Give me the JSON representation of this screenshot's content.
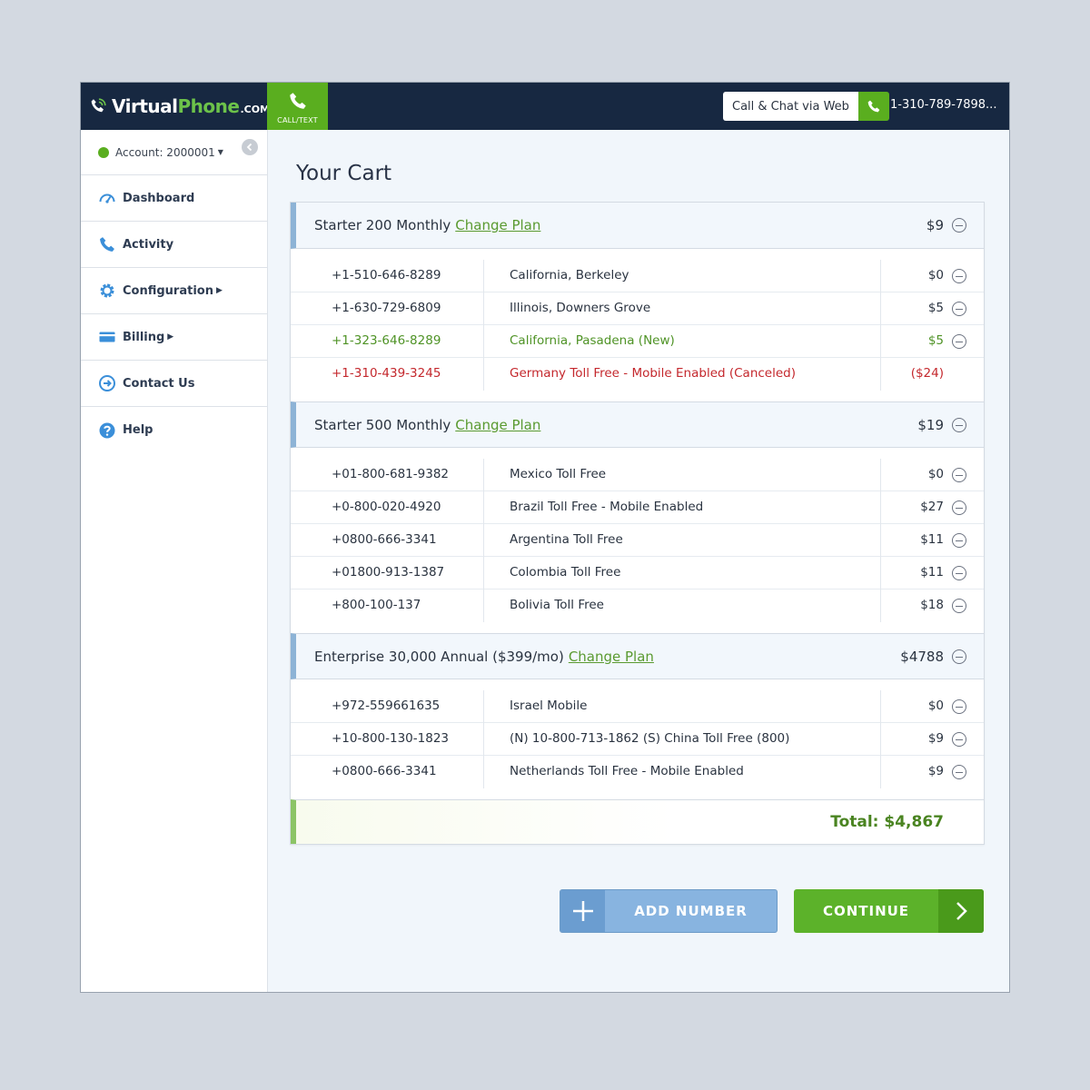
{
  "header": {
    "logo_virtual": "Virtual",
    "logo_phone": "Phone",
    "logo_com": ".COM",
    "call_text_label": "CALL/TEXT",
    "web_call_label": "Call & Chat via Web",
    "phone_number": "1-310-789-7898..."
  },
  "sidebar": {
    "account_label": "Account: 2000001",
    "items": [
      {
        "label": "Dashboard",
        "icon": "dashboard-icon"
      },
      {
        "label": "Activity",
        "icon": "phone-icon"
      },
      {
        "label": "Configuration",
        "icon": "gear-icon",
        "has_caret": true
      },
      {
        "label": "Billing",
        "icon": "credit-card-icon",
        "has_caret": true
      },
      {
        "label": "Contact Us",
        "icon": "contact-icon"
      },
      {
        "label": "Help",
        "icon": "help-icon"
      }
    ]
  },
  "main": {
    "title": "Your Cart",
    "change_plan_label": "Change Plan",
    "plans": [
      {
        "name": "Starter 200 Monthly",
        "price": "$9",
        "lines": [
          {
            "number": "+1-510-646-8289",
            "location": "California, Berkeley",
            "price": "$0",
            "status": "normal"
          },
          {
            "number": "+1-630-729-6809",
            "location": "Illinois, Downers Grove",
            "price": "$5",
            "status": "normal"
          },
          {
            "number": "+1-323-646-8289",
            "location": "California, Pasadena (New)",
            "price": "$5",
            "status": "new"
          },
          {
            "number": "+1-310-439-3245",
            "location": "Germany Toll Free - Mobile Enabled (Canceled)",
            "price": "($24)",
            "status": "canceled"
          }
        ]
      },
      {
        "name": "Starter 500 Monthly",
        "price": "$19",
        "lines": [
          {
            "number": "+01-800-681-9382",
            "location": "Mexico Toll Free",
            "price": "$0",
            "status": "normal"
          },
          {
            "number": "+0-800-020-4920",
            "location": "Brazil Toll Free - Mobile Enabled",
            "price": "$27",
            "status": "normal"
          },
          {
            "number": "+0800-666-3341",
            "location": "Argentina Toll Free",
            "price": "$11",
            "status": "normal"
          },
          {
            "number": "+01800-913-1387",
            "location": "Colombia Toll Free",
            "price": "$11",
            "status": "normal"
          },
          {
            "number": "+800-100-137",
            "location": "Bolivia Toll Free",
            "price": "$18",
            "status": "normal"
          }
        ]
      },
      {
        "name": "Enterprise 30,000 Annual ($399/mo)",
        "price": "$4788",
        "lines": [
          {
            "number": "+972-559661635",
            "location": "Israel Mobile",
            "price": "$0",
            "status": "normal"
          },
          {
            "number": "+10-800-130-1823",
            "location": "(N) 10-800-713-1862 (S) China Toll Free (800)",
            "price": "$9",
            "status": "normal"
          },
          {
            "number": "+0800-666-3341",
            "location": "Netherlands Toll Free - Mobile Enabled",
            "price": "$9",
            "status": "normal"
          }
        ]
      }
    ],
    "total_label": "Total: $4,867",
    "add_number_label": "ADD NUMBER",
    "continue_label": "CONTINUE"
  },
  "colors": {
    "navy": "#172841",
    "brand_green": "#5aae1f",
    "new_green": "#4f9326",
    "cancel_red": "#c4282d",
    "plan_accent_blue": "#8db3d6",
    "button_blue": "#88b4e0"
  }
}
